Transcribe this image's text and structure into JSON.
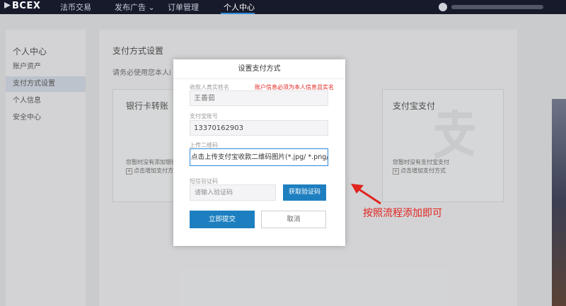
{
  "nav": {
    "logo": "BCEX",
    "items": [
      "法币交易",
      "发布广告",
      "订单管理",
      "个人中心"
    ],
    "dropdown_arrow": "⌄"
  },
  "sidebar": {
    "title": "个人中心",
    "items": [
      "账户资产",
      "支付方式设置",
      "个人信息",
      "安全中心"
    ]
  },
  "main": {
    "title": "支付方式设置",
    "note": "请务必使用您本人的实",
    "cards": [
      {
        "title": "银行卡转账",
        "empty": "您暂时没有添加银行",
        "add": "点击增加支付方式"
      },
      {
        "title": "支付宝支付",
        "empty": "您暂时没有支付宝支付",
        "add": "点击增加支付方式"
      }
    ]
  },
  "modal": {
    "title": "设置支付方式",
    "name_label": "收款人真实姓名",
    "name_warning": "账户信息必须为本人信息且实名",
    "name_value": "王善茹",
    "account_label": "支付宝账号",
    "account_value": "13370162903",
    "qr_label": "上传二维码",
    "qr_value": "点击上传支付宝收款二维码图片(*.jpg/ *.png/ *.jpeg)",
    "sms_label": "短信验证码",
    "sms_placeholder": "请输入验证码",
    "sms_button": "获取验证码",
    "submit": "立即提交",
    "cancel": "取消"
  },
  "annotation": {
    "text": "按照流程添加即可",
    "color": "#e0241f"
  }
}
